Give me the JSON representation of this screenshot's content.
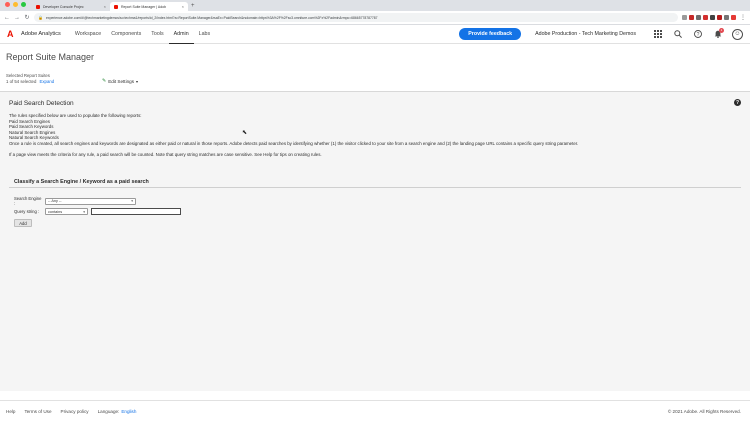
{
  "browser": {
    "tabs": [
      {
        "title": "Developer Console Projec",
        "active": false
      },
      {
        "title": "Report Suite Manager | Adob",
        "active": true
      }
    ],
    "new_tab": "+",
    "url": "experience.adobe.com/#/@techmarketingdemos/so:techma1/reports/id_2/index.html?a=ReportSuite.Manager&rsaEx=PaidSearch&rsdomain=https%3A%2F%2Fsc3.omniture.com%2Fx%2Fadmin&rmpc=68665778787787",
    "traffic_colors": [
      "#ff5f57",
      "#febc2e",
      "#28c840"
    ],
    "ext_colors": [
      "#9a9a9a",
      "#c62828",
      "#6d6d6d",
      "#d32f2f",
      "#424242",
      "#b71c1c",
      "#757575",
      "#e53935"
    ]
  },
  "header": {
    "app_name": "Adobe Analytics",
    "menu": [
      {
        "label": "Workspace",
        "active": false
      },
      {
        "label": "Components",
        "active": false
      },
      {
        "label": "Tools",
        "active": false
      },
      {
        "label": "Admin",
        "active": true
      },
      {
        "label": "Labs",
        "active": false
      }
    ],
    "feedback_label": "Provide feedback",
    "org_name": "Adobe Production - Tech Marketing Demos",
    "bell_count": "1",
    "brand_color": "#eb1000",
    "accent_color": "#1473e6"
  },
  "page": {
    "title": "Report Suite Manager",
    "selected_label": "Selected Report Suites",
    "selected_count": "1 of 54 selected",
    "expand_label": "Expand",
    "edit_settings_label": "Edit Settings"
  },
  "section": {
    "title": "Paid Search Detection",
    "help_glyph": "?",
    "lines": [
      "The rules specified below are used to populate the following reports:",
      "Paid Search Engines",
      "Paid Search Keywords",
      "Natural Search Engines",
      "Natural Search Keywords",
      "Once a rule is created, all search engines and keywords are designated as either paid or natural in those reports. Adobe detects paid searches by identifying whether (1) the visitor clicked to your site from a search engine and (2) the landing page URL contains a specific query string parameter."
    ],
    "note": "If a page view meets the criteria for any rule, a paid search will be counted. Note that query string matches are case sensitive. See Help for tips on creating rules."
  },
  "classify": {
    "title": "Classify a Search Engine / Keyword as a paid search",
    "search_engine_label": "Search Engine :",
    "search_engine_value": "-- Any --",
    "query_string_label": "Query string :",
    "query_operator_value": "contains",
    "query_value": "",
    "add_label": "Add"
  },
  "footer": {
    "help": "Help",
    "terms": "Terms of Use",
    "privacy": "Privacy policy",
    "language_label": "Language:",
    "language_value": "English",
    "copyright": "© 2021 Adobe. All Rights Reserved."
  }
}
